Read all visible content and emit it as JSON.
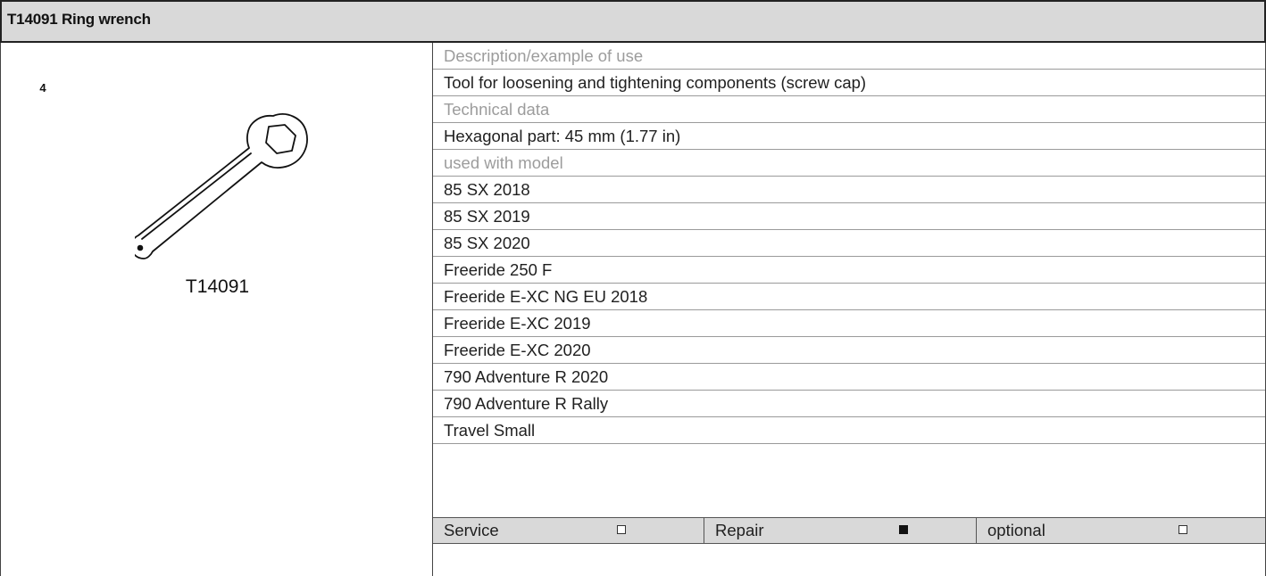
{
  "header": {
    "title": "T14091 Ring wrench"
  },
  "figure": {
    "badge_number": "4",
    "tool_code": "T14091"
  },
  "details": {
    "description_label": "Description/example of use",
    "description_value": "Tool for loosening and tightening components (screw cap)",
    "technical_label": "Technical data",
    "technical_value": "Hexagonal part: 45 mm (1.77 in)",
    "models_label": "used with model",
    "models": [
      "85 SX 2018",
      "85 SX 2019",
      "85 SX 2020",
      "Freeride 250 F",
      "Freeride E-XC NG EU 2018",
      "Freeride E-XC 2019",
      "Freeride E-XC 2020",
      "790 Adventure R 2020",
      "790 Adventure R Rally",
      "Travel Small"
    ]
  },
  "flags": [
    {
      "label": "Service",
      "checked": false
    },
    {
      "label": "Repair",
      "checked": true
    },
    {
      "label": "optional",
      "checked": false
    }
  ]
}
